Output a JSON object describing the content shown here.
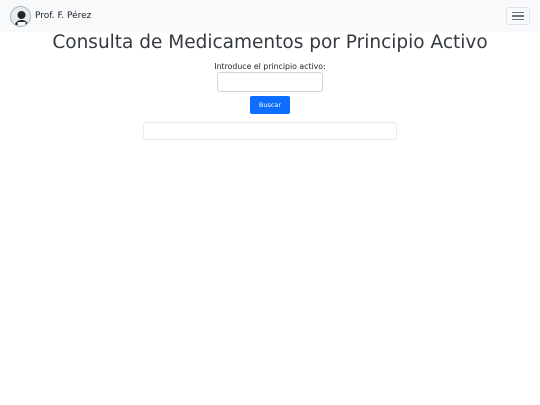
{
  "navbar": {
    "brand_text": "Prof. F. Pérez",
    "avatar_icon": "person-avatar-icon",
    "toggler_icon": "hamburger-menu-icon"
  },
  "main": {
    "title": "Consulta de Medicamentos por Principio Activo",
    "input_label": "Introduce el principio activo:",
    "input_value": "",
    "input_placeholder": "",
    "search_button_label": "Buscar",
    "results": []
  },
  "colors": {
    "navbar_bg": "#f8f9fa",
    "accent": "#0d6efd"
  }
}
